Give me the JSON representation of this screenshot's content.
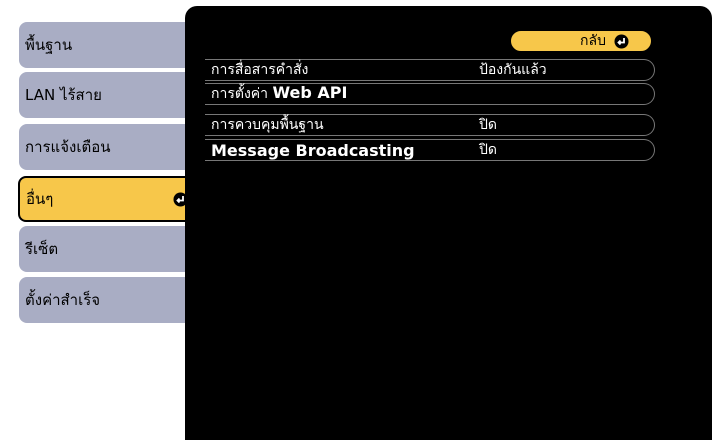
{
  "tabs": [
    {
      "label": "พื้นฐาน"
    },
    {
      "label": "LAN ไร้สาย"
    },
    {
      "label": "การแจ้งเตือน"
    },
    {
      "label": "อื่นๆ"
    },
    {
      "label": "รีเซ็ต"
    },
    {
      "label": "ตั้งค่าสำเร็จ"
    }
  ],
  "back_button": {
    "label": "กลับ"
  },
  "settings": [
    {
      "label": "การสื่อสารคำสั่ง",
      "value": "ป้องกันแล้ว"
    },
    {
      "label_prefix": "การตั้งค่า ",
      "label_bold": "Web API",
      "value": ""
    },
    {
      "label": "การควบคุมพื้นฐาน",
      "value": "ปิด"
    },
    {
      "label": "Message Broadcasting",
      "value": "ปิด"
    }
  ],
  "colors": {
    "tab_inactive": "#a9adc4",
    "tab_active": "#f7c74a",
    "panel": "#000000"
  }
}
